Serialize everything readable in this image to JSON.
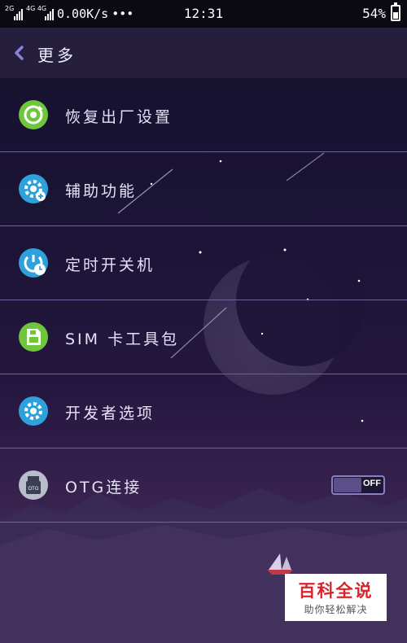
{
  "status_bar": {
    "network_1": "2G",
    "network_2": "4G 4G",
    "speed": "0.00K/s",
    "more": "•••",
    "time": "12:31",
    "battery": "54%",
    "battery_level": 0.54
  },
  "header": {
    "title": "更多"
  },
  "menu": {
    "items": [
      {
        "label": "恢复出厂设置",
        "icon": "factory-reset-icon",
        "color": "#6ec63a"
      },
      {
        "label": "辅助功能",
        "icon": "accessibility-gear-icon",
        "color": "#2ea0dc"
      },
      {
        "label": "定时开关机",
        "icon": "scheduled-power-icon",
        "color": "#2ea0dc"
      },
      {
        "label": "SIM 卡工具包",
        "icon": "sim-toolkit-icon",
        "color": "#6ec63a"
      },
      {
        "label": "开发者选项",
        "icon": "developer-gear-icon",
        "color": "#2ea0dc"
      },
      {
        "label": "OTG连接",
        "icon": "otg-usb-icon",
        "color": "#9aa0b5",
        "toggle": "OFF"
      }
    ]
  },
  "watermark": {
    "title": "百科全说",
    "subtitle": "助你轻松解决"
  }
}
